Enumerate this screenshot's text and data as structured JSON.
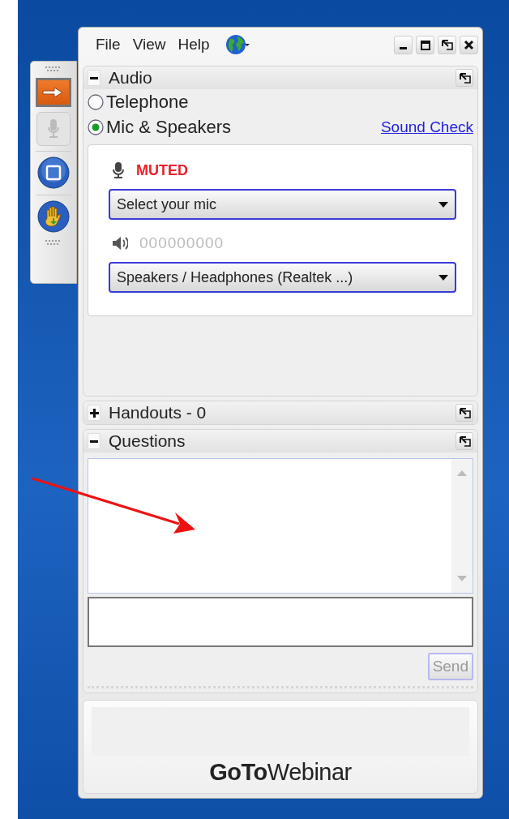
{
  "menu": [
    {
      "label": "File"
    },
    {
      "label": "View"
    },
    {
      "label": "Help"
    }
  ],
  "audio": {
    "title": "Audio",
    "expanded": true,
    "options": [
      {
        "label": "Telephone",
        "selected": false
      },
      {
        "label": "Mic & Speakers",
        "selected": true
      }
    ],
    "link": "Sound Check",
    "mic_status": "MUTED",
    "mic_select": "Select your mic",
    "speaker_level": "000000000",
    "speaker_select": "Speakers / Headphones (Realtek ...)"
  },
  "handouts": {
    "title": "Handouts - 0",
    "expanded": false
  },
  "questions": {
    "title": "Questions",
    "expanded": true,
    "send": {
      "label": "Send",
      "disabled": true
    }
  },
  "logo": "**GoTo**Webinar"
}
